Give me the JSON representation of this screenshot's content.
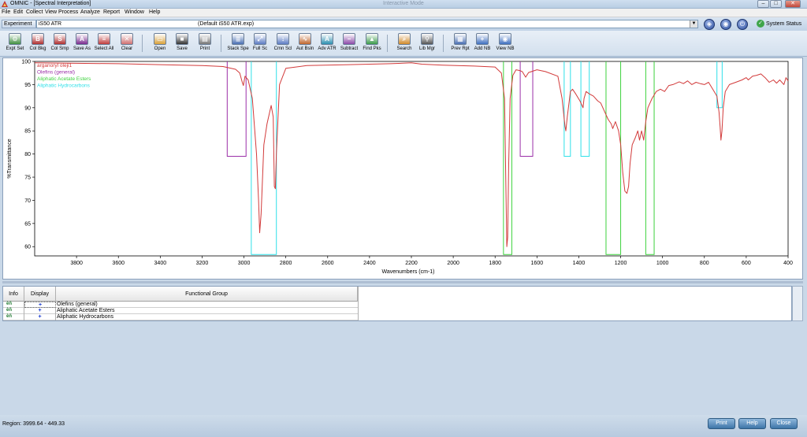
{
  "window": {
    "title": "OMNIC - [Spectral Interpretation]",
    "center_title": "Interactive Mode",
    "minimize": "–",
    "maximize": "□",
    "close": "✕"
  },
  "menu": [
    "File",
    "Edit",
    "Collect",
    "View",
    "Process",
    "Analyze",
    "Report",
    "Window",
    "Help"
  ],
  "experiment": {
    "label": "Experiment",
    "value": "iS50 ATR",
    "default_text": "(Default iS50 ATR.exp)",
    "system_status": "System Status"
  },
  "toolbar": [
    {
      "label": "Expt Set",
      "icon": "experiment-setup-icon",
      "color": "#3f8f3f",
      "glyph": "⚙"
    },
    {
      "label": "Col Bkg",
      "icon": "collect-background-icon",
      "color": "#b03030",
      "glyph": "B"
    },
    {
      "label": "Col Smp",
      "icon": "collect-sample-icon",
      "color": "#b03030",
      "glyph": "S"
    },
    {
      "label": "Save As",
      "icon": "save-as-icon",
      "color": "#7a2b8f",
      "glyph": "A"
    },
    {
      "label": "Select All",
      "icon": "select-all-icon",
      "color": "#c03c3c",
      "glyph": "≡"
    },
    {
      "label": "Clear",
      "icon": "clear-icon",
      "color": "#d07070",
      "glyph": "✕"
    },
    {
      "label": "Open",
      "icon": "open-folder-icon",
      "color": "#d8a13a",
      "glyph": "▭"
    },
    {
      "label": "Save",
      "icon": "save-disk-icon",
      "color": "#333333",
      "glyph": "■"
    },
    {
      "label": "Print",
      "icon": "print-icon",
      "color": "#777777",
      "glyph": "▤"
    },
    {
      "label": "Stack Spe",
      "icon": "stack-spectra-icon",
      "color": "#4a6fb3",
      "glyph": "≣"
    },
    {
      "label": "Full Sc",
      "icon": "full-scale-icon",
      "color": "#5d7cc4",
      "glyph": "⤢"
    },
    {
      "label": "Cmn Scl",
      "icon": "common-scale-icon",
      "color": "#5d7cc4",
      "glyph": "↕"
    },
    {
      "label": "Aut Bsln",
      "icon": "auto-baseline-icon",
      "color": "#c0662e",
      "glyph": "∿"
    },
    {
      "label": "Adv ATR",
      "icon": "advanced-atr-icon",
      "color": "#2c8fb0",
      "glyph": "A"
    },
    {
      "label": "Subtract",
      "icon": "subtract-icon",
      "color": "#8c4aa8",
      "glyph": "−"
    },
    {
      "label": "Find Pks",
      "icon": "find-peaks-icon",
      "color": "#3a9a4a",
      "glyph": "▲"
    },
    {
      "label": "Search",
      "icon": "search-icon",
      "color": "#d08a2a",
      "glyph": "⌕"
    },
    {
      "label": "Lib Mgr",
      "icon": "library-manager-icon",
      "color": "#555555",
      "glyph": "⚲"
    },
    {
      "label": "Prev Rpt",
      "icon": "preview-report-icon",
      "color": "#4a6fb3",
      "glyph": "▦"
    },
    {
      "label": "Add NB",
      "icon": "add-notebook-icon",
      "color": "#3f6fc0",
      "glyph": "+"
    },
    {
      "label": "View NB",
      "icon": "view-notebook-icon",
      "color": "#3f6fc0",
      "glyph": "◉"
    }
  ],
  "chart_data": {
    "type": "line",
    "xlabel": "Wavenumbers (cm-1)",
    "ylabel": "%Transmittance",
    "xlim": [
      4000,
      400
    ],
    "ylim": [
      58,
      100
    ],
    "x_ticks": [
      3800,
      3600,
      3400,
      3200,
      3000,
      2800,
      2600,
      2400,
      2200,
      2000,
      1800,
      1600,
      1400,
      1200,
      1000,
      800,
      600,
      400
    ],
    "y_ticks": [
      60,
      65,
      70,
      75,
      80,
      85,
      90,
      95,
      100
    ],
    "legend": [
      {
        "name": "arganoryl oleji1",
        "color": "#d23a3a"
      },
      {
        "name": "Olefins (general)",
        "color": "#9b2fa8"
      },
      {
        "name": "Aliphatic Acetate Esters",
        "color": "#3fd23f"
      },
      {
        "name": "Aliphatic Hydrocarbons",
        "color": "#2fe0e8"
      }
    ],
    "series": [
      {
        "color": "#d23a3a",
        "points": [
          [
            4000,
            99.7
          ],
          [
            3800,
            99.6
          ],
          [
            3600,
            99.5
          ],
          [
            3400,
            99.3
          ],
          [
            3200,
            99.1
          ],
          [
            3100,
            98.9
          ],
          [
            3040,
            98.3
          ],
          [
            3020,
            97.5
          ],
          [
            3008,
            95.5
          ],
          [
            3003,
            94.8
          ],
          [
            2995,
            96.8
          ],
          [
            2980,
            96.0
          ],
          [
            2960,
            92.0
          ],
          [
            2940,
            80.0
          ],
          [
            2930,
            70.0
          ],
          [
            2925,
            63.0
          ],
          [
            2918,
            67.0
          ],
          [
            2905,
            82.0
          ],
          [
            2890,
            86.5
          ],
          [
            2870,
            90.5
          ],
          [
            2860,
            88.0
          ],
          [
            2855,
            73.0
          ],
          [
            2850,
            72.5
          ],
          [
            2845,
            80.0
          ],
          [
            2830,
            95.0
          ],
          [
            2800,
            98.5
          ],
          [
            2700,
            99.1
          ],
          [
            2500,
            99.3
          ],
          [
            2300,
            99.5
          ],
          [
            2200,
            99.7
          ],
          [
            2150,
            99.4
          ],
          [
            2050,
            99.2
          ],
          [
            1900,
            99.0
          ],
          [
            1800,
            98.8
          ],
          [
            1770,
            97.5
          ],
          [
            1755,
            92.0
          ],
          [
            1748,
            72.0
          ],
          [
            1744,
            60.0
          ],
          [
            1740,
            62.0
          ],
          [
            1735,
            78.0
          ],
          [
            1728,
            92.0
          ],
          [
            1715,
            97.0
          ],
          [
            1700,
            98.2
          ],
          [
            1680,
            98.0
          ],
          [
            1670,
            97.8
          ],
          [
            1654,
            96.6
          ],
          [
            1640,
            97.6
          ],
          [
            1600,
            98.2
          ],
          [
            1560,
            97.8
          ],
          [
            1500,
            96.8
          ],
          [
            1480,
            92.0
          ],
          [
            1466,
            86.0
          ],
          [
            1462,
            85.0
          ],
          [
            1455,
            88.0
          ],
          [
            1440,
            93.5
          ],
          [
            1430,
            94.0
          ],
          [
            1415,
            93.0
          ],
          [
            1395,
            91.5
          ],
          [
            1380,
            90.0
          ],
          [
            1375,
            92.0
          ],
          [
            1365,
            93.5
          ],
          [
            1350,
            93.0
          ],
          [
            1330,
            92.5
          ],
          [
            1310,
            91.5
          ],
          [
            1295,
            91.0
          ],
          [
            1275,
            89.0
          ],
          [
            1260,
            87.5
          ],
          [
            1245,
            86.5
          ],
          [
            1238,
            85.5
          ],
          [
            1225,
            87.0
          ],
          [
            1210,
            85.0
          ],
          [
            1200,
            82.0
          ],
          [
            1190,
            76.0
          ],
          [
            1180,
            72.0
          ],
          [
            1170,
            71.5
          ],
          [
            1162,
            73.0
          ],
          [
            1155,
            78.0
          ],
          [
            1145,
            82.0
          ],
          [
            1130,
            83.5
          ],
          [
            1118,
            85.0
          ],
          [
            1110,
            83.0
          ],
          [
            1100,
            85.0
          ],
          [
            1090,
            83.0
          ],
          [
            1080,
            87.0
          ],
          [
            1070,
            90.0
          ],
          [
            1050,
            92.0
          ],
          [
            1030,
            93.5
          ],
          [
            1010,
            94.0
          ],
          [
            990,
            93.5
          ],
          [
            970,
            94.8
          ],
          [
            950,
            95.0
          ],
          [
            920,
            95.6
          ],
          [
            900,
            95.2
          ],
          [
            880,
            95.8
          ],
          [
            860,
            95.0
          ],
          [
            840,
            95.5
          ],
          [
            820,
            95.2
          ],
          [
            800,
            95.0
          ],
          [
            780,
            95.5
          ],
          [
            760,
            94.0
          ],
          [
            740,
            92.5
          ],
          [
            730,
            89.0
          ],
          [
            725,
            86.0
          ],
          [
            721,
            83.0
          ],
          [
            716,
            85.0
          ],
          [
            710,
            90.0
          ],
          [
            700,
            93.5
          ],
          [
            680,
            95.0
          ],
          [
            650,
            95.5
          ],
          [
            620,
            96.0
          ],
          [
            600,
            96.5
          ],
          [
            590,
            96.0
          ],
          [
            570,
            96.8
          ],
          [
            550,
            97.0
          ],
          [
            530,
            97.3
          ],
          [
            510,
            96.5
          ],
          [
            490,
            95.5
          ],
          [
            470,
            96.0
          ],
          [
            455,
            95.3
          ],
          [
            440,
            96.0
          ],
          [
            420,
            95.0
          ],
          [
            410,
            96.5
          ],
          [
            400,
            95.8
          ]
        ]
      }
    ],
    "regions": [
      {
        "group": "Olefins (general)",
        "color": "#9b2fa8",
        "x1": 3080,
        "x2": 2990,
        "y_low": 79.5
      },
      {
        "group": "Olefins (general)",
        "color": "#9b2fa8",
        "x1": 1680,
        "x2": 1620,
        "y_low": 79.5
      },
      {
        "group": "Aliphatic Hydrocarbons",
        "color": "#2fe0e8",
        "x1": 2965,
        "x2": 2845,
        "y_low": 58.3
      },
      {
        "group": "Aliphatic Hydrocarbons",
        "color": "#2fe0e8",
        "x1": 1470,
        "x2": 1440,
        "y_low": 79.5
      },
      {
        "group": "Aliphatic Hydrocarbons",
        "color": "#2fe0e8",
        "x1": 1390,
        "x2": 1350,
        "y_low": 79.5
      },
      {
        "group": "Aliphatic Hydrocarbons",
        "color": "#2fe0e8",
        "x1": 740,
        "x2": 715,
        "y_low": 90.0
      },
      {
        "group": "Aliphatic Acetate Esters",
        "color": "#3fd23f",
        "x1": 1760,
        "x2": 1720,
        "y_low": 58.3
      },
      {
        "group": "Aliphatic Acetate Esters",
        "color": "#3fd23f",
        "x1": 1270,
        "x2": 1200,
        "y_low": 58.3
      },
      {
        "group": "Aliphatic Acetate Esters",
        "color": "#3fd23f",
        "x1": 1080,
        "x2": 1040,
        "y_low": 58.3
      }
    ]
  },
  "table": {
    "columns": [
      "Info",
      "Display",
      "Functional Group"
    ],
    "rows": [
      {
        "info": "info-icon",
        "display": "+",
        "group": "Olefins (general)"
      },
      {
        "info": "info-icon",
        "display": "+",
        "group": "Aliphatic Acetate Esters"
      },
      {
        "info": "info-icon",
        "display": "+",
        "group": "Aliphatic Hydrocarbons"
      }
    ]
  },
  "status": {
    "region_label": "Region:",
    "region_value": "3999.64  -  449.33",
    "buttons": [
      "Print",
      "Help",
      "Close"
    ]
  }
}
